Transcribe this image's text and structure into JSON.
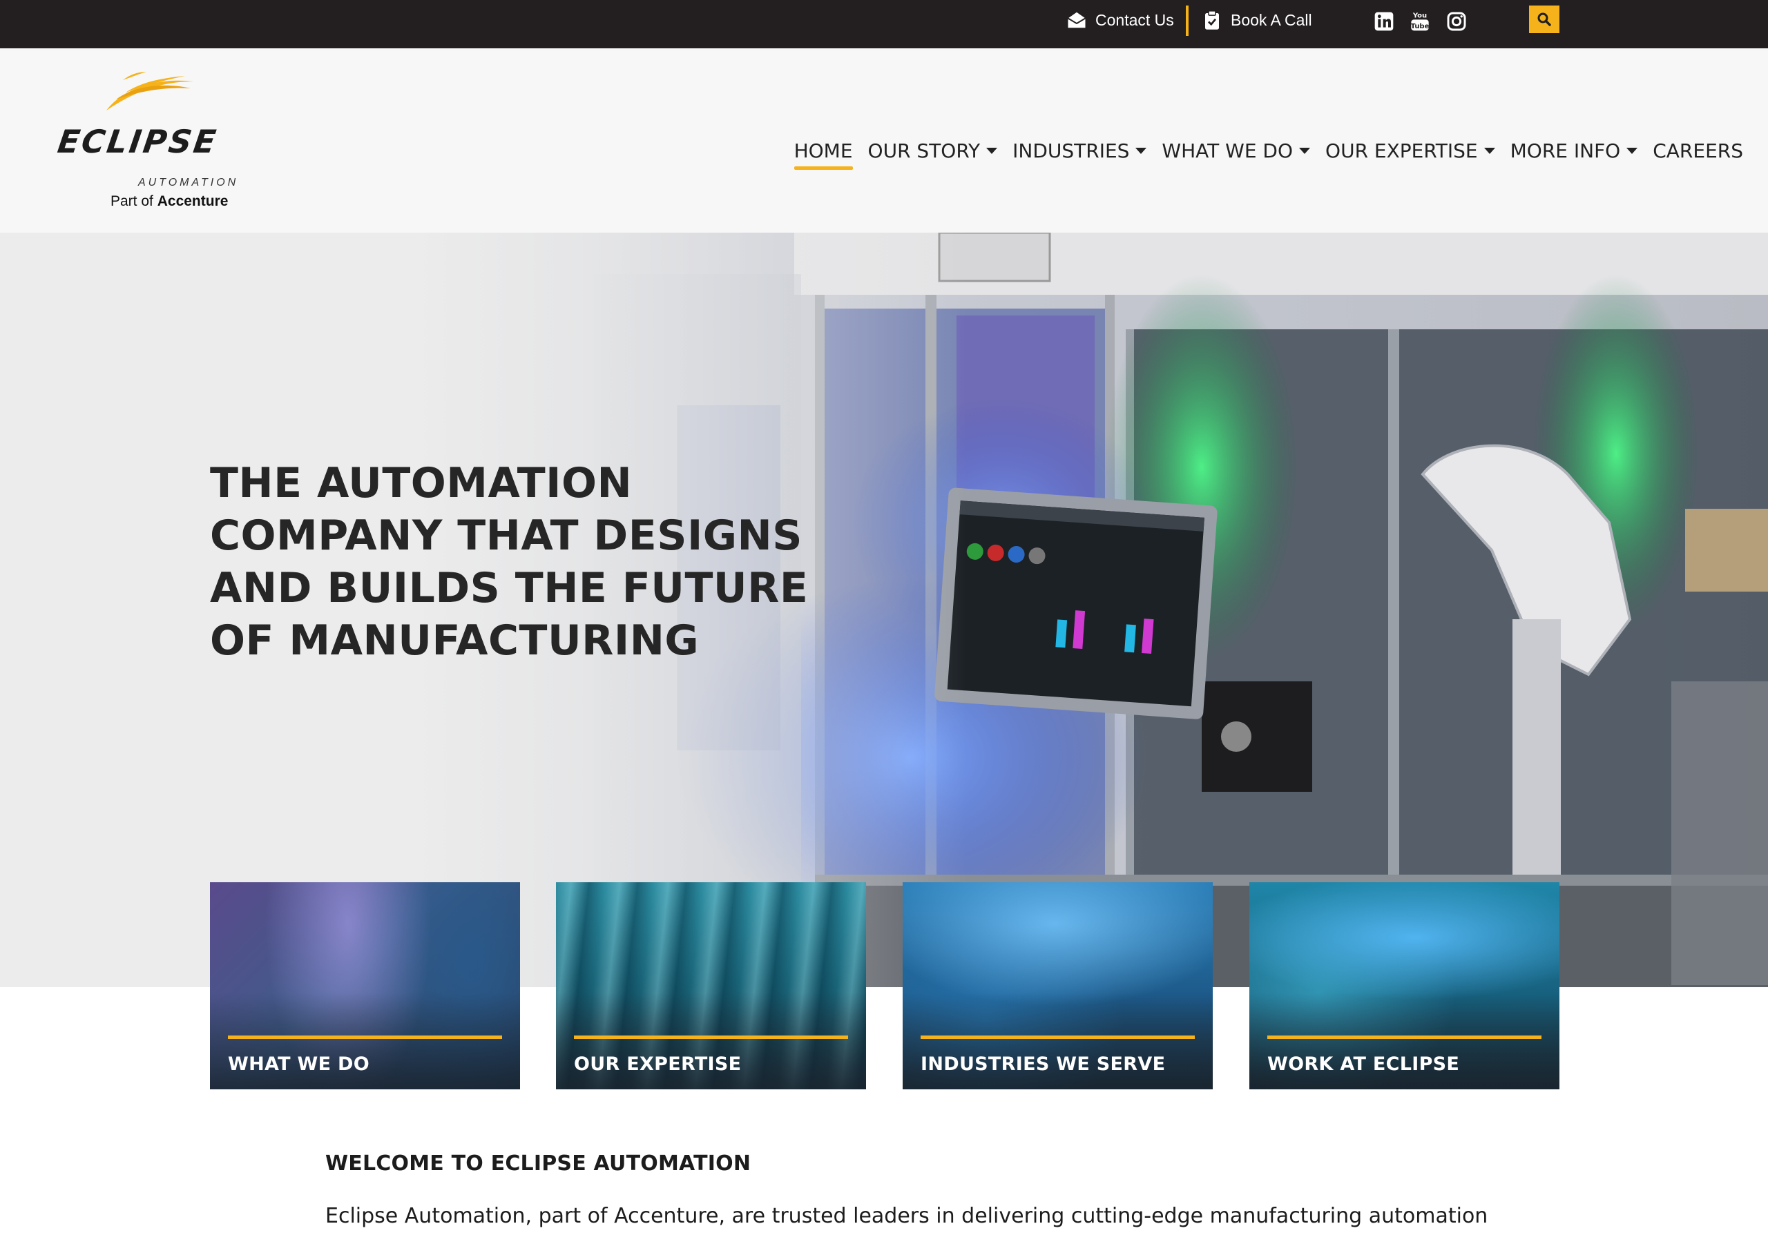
{
  "topbar": {
    "contact_label": "Contact Us",
    "book_label": "Book A Call",
    "social": [
      "linkedin-icon",
      "youtube-icon",
      "instagram-icon"
    ],
    "accent": "#f5b21b",
    "background": "#231f20"
  },
  "brand": {
    "name": "ECLIPSE",
    "sub": "AUTOMATION",
    "part_of": "Part of",
    "parent": "Accenture"
  },
  "nav": {
    "items": [
      {
        "label": "HOME",
        "active": true,
        "dropdown": false
      },
      {
        "label": "OUR STORY",
        "dropdown": true
      },
      {
        "label": "INDUSTRIES",
        "dropdown": true
      },
      {
        "label": "WHAT WE DO",
        "dropdown": true
      },
      {
        "label": "OUR EXPERTISE",
        "dropdown": true
      },
      {
        "label": "MORE INFO",
        "dropdown": true
      },
      {
        "label": "CAREERS",
        "dropdown": false
      }
    ]
  },
  "hero": {
    "lines": [
      "THE AUTOMATION",
      "COMPANY THAT DESIGNS",
      "AND BUILDS THE FUTURE",
      "OF MANUFACTURING"
    ]
  },
  "cards": [
    {
      "label": "WHAT WE DO"
    },
    {
      "label": "OUR EXPERTISE"
    },
    {
      "label": "INDUSTRIES WE SERVE"
    },
    {
      "label": "WORK AT ECLIPSE"
    }
  ],
  "welcome": {
    "title": "WELCOME TO ECLIPSE AUTOMATION",
    "text": "Eclipse Automation, part of Accenture, are trusted leaders in delivering cutting-edge manufacturing automation"
  }
}
